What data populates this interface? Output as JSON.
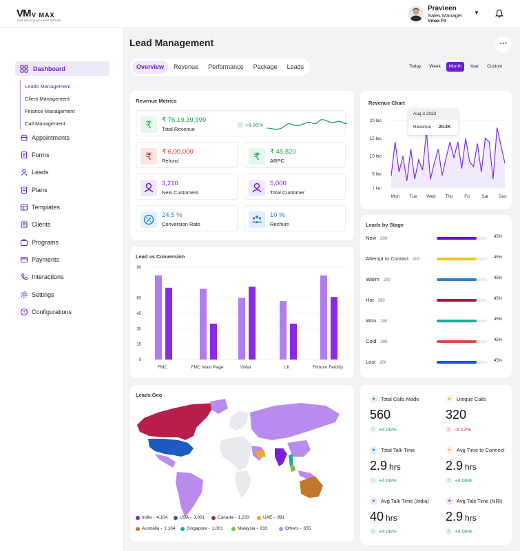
{
  "brand": {
    "mark": "VM",
    "name": "V MAX",
    "tagline": "YOUR HOLISTIC WELLNESS PARTNER"
  },
  "user": {
    "name": "Pravieen",
    "role": "Sales Manager",
    "org": "Vmax Fit"
  },
  "icons": {
    "bell": "bell-icon",
    "caret": "chevron-down-icon",
    "more": "more-dots-icon"
  },
  "colors": {
    "accent": "#6a20c9",
    "positive": "#1f9d55",
    "negative": "#d93025"
  },
  "sidebar": {
    "dashboard": "Dashboard",
    "sub_items": [
      "Leads Management",
      "Client Management",
      "Finance Management",
      "Call Management"
    ],
    "items": [
      "Appointments",
      "Forms",
      "Leads",
      "Plans",
      "Templates",
      "Clients",
      "Programs",
      "Payments",
      "Interactions",
      "Settings",
      "Configurations"
    ]
  },
  "page": {
    "title": "Lead Management"
  },
  "tabs": [
    "Overview",
    "Revenue",
    "Performance",
    "Package",
    "Leads"
  ],
  "ranges": [
    "Today",
    "Week",
    "Month",
    "Year",
    "Custom"
  ],
  "revenue_metrics": {
    "title": "Revenue Metrics",
    "total_revenue": {
      "value": "₹ 76,19,39,999",
      "label": "Total Revenue",
      "change": "+4.06%"
    },
    "refund": {
      "value": "₹ 6,00,000",
      "label": "Refund"
    },
    "arpc": {
      "value": "₹ 45,820",
      "label": "ARPC"
    },
    "new_customers": {
      "value": "3,210",
      "label": "New Customers"
    },
    "total_customer": {
      "value": "5,000",
      "label": "Total Customer"
    },
    "conversion": {
      "value": "24.5 %",
      "label": "Conversion Rate"
    },
    "rechurn": {
      "value": "10 %",
      "label": "Rechurn"
    }
  },
  "revenue_chart": {
    "title": "Revenue Chart",
    "tooltip": {
      "date": "Aug 3 2023",
      "label": "Revenue",
      "value": "20.3K"
    }
  },
  "lead_conversion": {
    "title": "Lead vs Conversion"
  },
  "leads_stage": {
    "title": "Leads by Stage",
    "stages": [
      {
        "name": "New",
        "count": "200",
        "pct": "45%",
        "fill": 0.8,
        "color": "#6a0fd9"
      },
      {
        "name": "Attempt to Contact",
        "count": "200",
        "pct": "45%",
        "fill": 0.8,
        "color": "#f2c318"
      },
      {
        "name": "Warm",
        "count": "200",
        "pct": "45%",
        "fill": 0.8,
        "color": "#2f80c6"
      },
      {
        "name": "Hot",
        "count": "200",
        "pct": "45%",
        "fill": 0.8,
        "color": "#b3123d"
      },
      {
        "name": "Won",
        "count": "200",
        "pct": "45%",
        "fill": 0.8,
        "color": "#1aab96"
      },
      {
        "name": "Cold",
        "count": "200",
        "pct": "45%",
        "fill": 0.8,
        "color": "#e24a4f"
      },
      {
        "name": "Lost",
        "count": "200",
        "pct": "45%",
        "fill": 0.8,
        "color": "#1a56d6"
      }
    ]
  },
  "geo": {
    "title": "Leads Geo",
    "legend": [
      {
        "label": "India -",
        "value": "4,104",
        "color": "#7a1fd8"
      },
      {
        "label": "USA -",
        "value": "3,001",
        "color": "#1d5bc2"
      },
      {
        "label": "Canada -",
        "value": "1,233",
        "color": "#b71f4a"
      },
      {
        "label": "UAE -",
        "value": "991",
        "color": "#f0a928"
      },
      {
        "label": "Australia -",
        "value": "1,104",
        "color": "#c0782b"
      },
      {
        "label": "Singapore -",
        "value": "1,001",
        "color": "#17a99b"
      },
      {
        "label": "Malaysia -",
        "value": "833",
        "color": "#7bc142"
      },
      {
        "label": "Others -",
        "value": "655",
        "color": "#b98bee"
      }
    ]
  },
  "stats": [
    {
      "title": "Total Calls Made",
      "value": "560",
      "unit": "",
      "change": "+4.06%",
      "up": true,
      "color": "#2f80c6"
    },
    {
      "title": "Unique Calls",
      "value": "320",
      "unit": "",
      "change": "-6.12%",
      "up": false,
      "color": "#f0a928"
    },
    {
      "title": "Total Talk Time",
      "value": "2.9",
      "unit": "hrs",
      "change": "+4.06%",
      "up": true,
      "color": "#2f80c6"
    },
    {
      "title": "Avg Time to Connect",
      "value": "2.9",
      "unit": "hrs",
      "change": "+4.06%",
      "up": true,
      "color": "#f0a928"
    },
    {
      "title": "Avg Talk Time (India)",
      "value": "40",
      "unit": "hrs",
      "change": "+4.06%",
      "up": true,
      "color": "#8e44d8"
    },
    {
      "title": "Avg Talk Time (NRI)",
      "value": "2.9",
      "unit": "hrs",
      "change": "+4.06%",
      "up": true,
      "color": "#8e44d8"
    }
  ],
  "chart_data": [
    {
      "type": "line",
      "title": "Revenue Chart",
      "x": [
        "Mon",
        "Tue",
        "Wed",
        "Thu",
        "Fri",
        "Sat",
        "Sun"
      ],
      "yticks": [
        "1 lac",
        "5 lac",
        "10 lac",
        "15 lac",
        "20 lac"
      ],
      "ylim": [
        1,
        20
      ],
      "grid": true,
      "values": [
        4.5,
        14,
        5.5,
        10,
        3,
        12,
        3.5,
        9,
        6,
        17,
        3.5,
        8,
        12,
        4.5,
        9.5,
        14,
        9.5,
        14,
        6.5,
        15,
        8.5,
        7,
        13.5,
        5.5,
        15,
        14,
        3.5,
        18,
        13,
        8
      ]
    },
    {
      "type": "bar",
      "title": "Lead vs Conversion",
      "categories": [
        "FMC",
        "FMC Main Page",
        "VMax",
        "LK",
        "Fitmom Fertility"
      ],
      "yticks": [
        "0",
        "15",
        "30",
        "45",
        "60",
        "90"
      ],
      "ylim": [
        0,
        90
      ],
      "grid": true,
      "series": [
        {
          "values": [
            82,
            69,
            60,
            57,
            82
          ],
          "color": "#b27df2"
        },
        {
          "values": [
            70,
            35,
            71,
            35,
            61
          ],
          "color": "#8a2be2"
        }
      ]
    }
  ]
}
